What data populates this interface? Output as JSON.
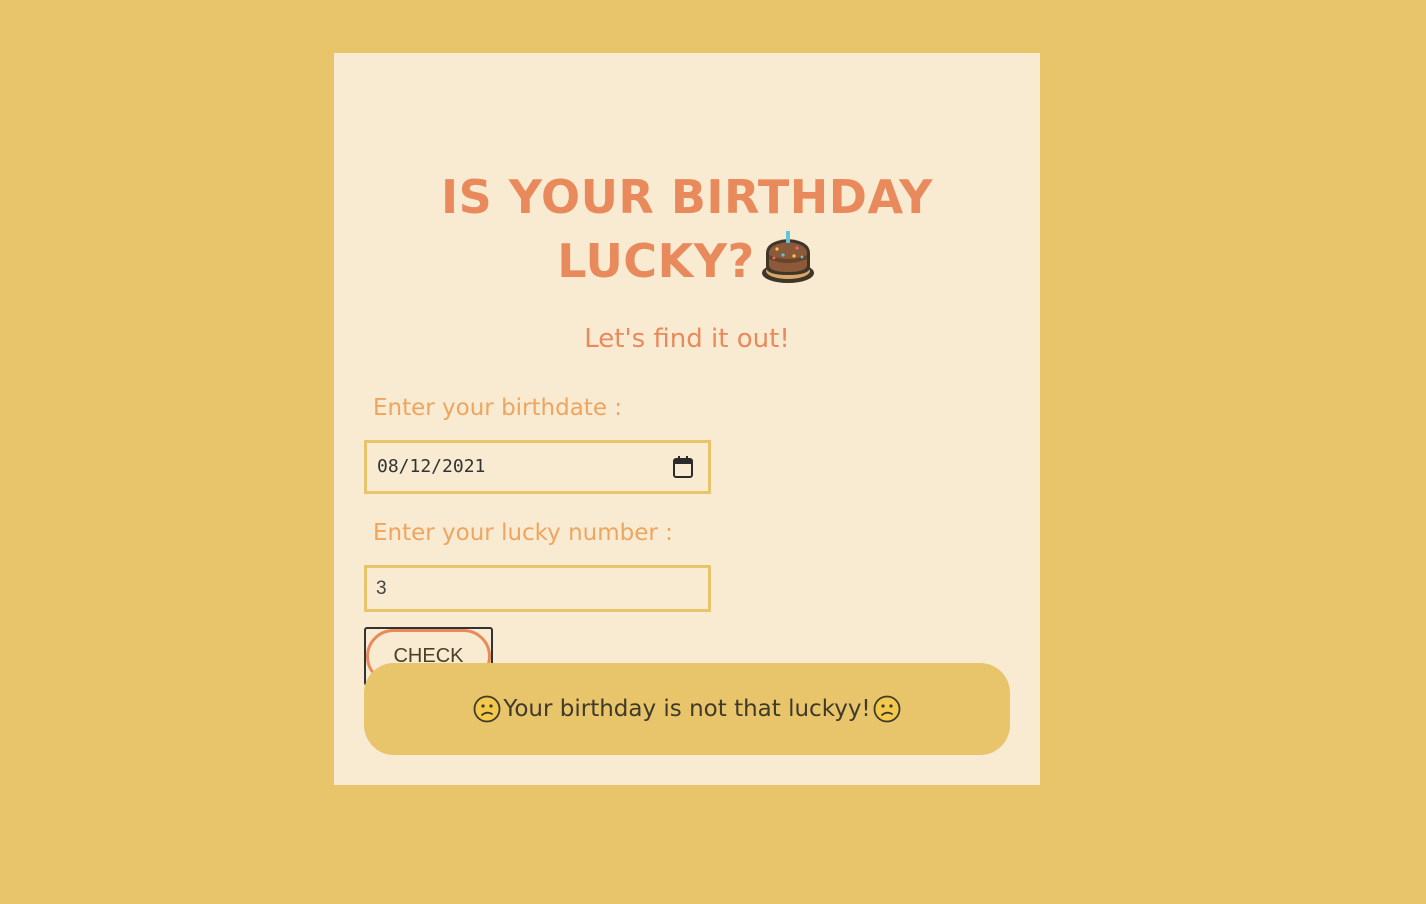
{
  "header": {
    "title_line1": "IS YOUR BIRTHDAY",
    "title_line2": "LUCKY?",
    "title_icon": "birthday-cake-icon",
    "subtitle": "Let's find it out!"
  },
  "form": {
    "birthdate_label": "Enter your birthdate :",
    "birthdate_value": "08/12/2021",
    "calendar_icon": "calendar-icon",
    "lucky_number_label": "Enter your lucky number :",
    "lucky_number_value": "3",
    "check_label": "CHECK"
  },
  "result": {
    "icon": "confused-face-icon",
    "message": "Your birthday is not that luckyy!"
  },
  "colors": {
    "page_background": "#e8c46a",
    "card_background": "#f8ebd2",
    "accent": "#e98a5c",
    "label": "#eea55f"
  }
}
